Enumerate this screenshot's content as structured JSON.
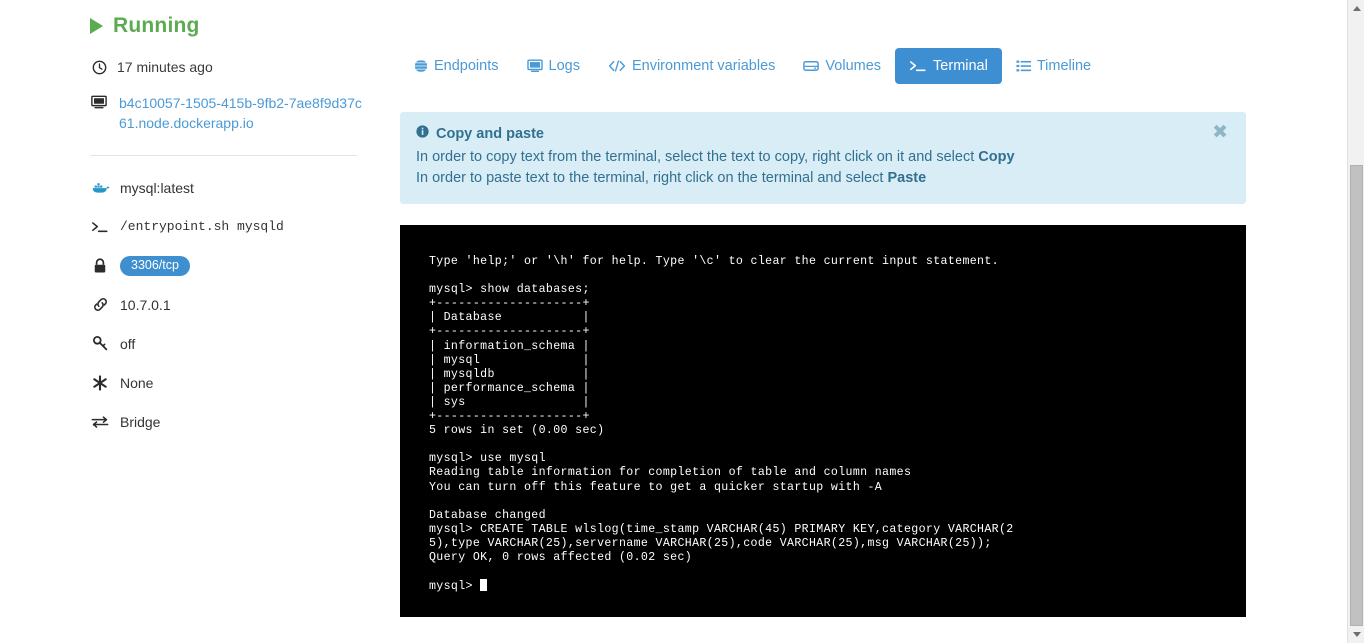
{
  "sidebar": {
    "status": {
      "label": "Running",
      "icon": "play-icon",
      "color": "#5cab52"
    },
    "uptime": {
      "icon": "clock-icon",
      "text": "17 minutes ago"
    },
    "host": {
      "icon": "monitor-icon",
      "link": "b4c10057-1505-415b-9fb2-7ae8f9d37c61.node.dockerapp.io"
    },
    "details": [
      {
        "icon": "docker-whale-icon",
        "label": "mysql:latest",
        "mono": false,
        "badge": false
      },
      {
        "icon": "terminal-prompt-icon",
        "label": "/entrypoint.sh mysqld",
        "mono": true,
        "badge": false
      },
      {
        "icon": "lock-icon",
        "label": "3306/tcp",
        "mono": false,
        "badge": true
      },
      {
        "icon": "link-icon",
        "label": "10.7.0.1",
        "mono": false,
        "badge": false
      },
      {
        "icon": "key-icon",
        "label": "off",
        "mono": false,
        "badge": false
      },
      {
        "icon": "asterisk-icon",
        "label": "None",
        "mono": false,
        "badge": false
      },
      {
        "icon": "exchange-arrows-icon",
        "label": "Bridge",
        "mono": false,
        "badge": false
      }
    ]
  },
  "tabs": [
    {
      "label": "Endpoints",
      "icon": "globe-icon",
      "active": false
    },
    {
      "label": "Logs",
      "icon": "monitor-icon",
      "active": false
    },
    {
      "label": "Environment variables",
      "icon": "code-brackets-icon",
      "active": false
    },
    {
      "label": "Volumes",
      "icon": "hdd-icon",
      "active": false
    },
    {
      "label": "Terminal",
      "icon": "terminal-prompt-icon",
      "active": true
    },
    {
      "label": "Timeline",
      "icon": "list-icon",
      "active": false
    }
  ],
  "banner": {
    "icon": "info-circle-icon",
    "title": "Copy and paste",
    "line1_prefix": "In order to copy text from the terminal, select the text to copy, right click on it and select ",
    "line1_bold": "Copy",
    "line2_prefix": "In order to paste text to the terminal, right click on the terminal and select ",
    "line2_bold": "Paste",
    "close_label": "✖",
    "bg_color": "#d9edf7",
    "text_color": "#31708f"
  },
  "terminal": {
    "background": "#000000",
    "text_color": "#ffffff",
    "content": "Type 'help;' or '\\h' for help. Type '\\c' to clear the current input statement.\n\nmysql> show databases;\n+--------------------+\n| Database           |\n+--------------------+\n| information_schema |\n| mysql              |\n| mysqldb            |\n| performance_schema |\n| sys                |\n+--------------------+\n5 rows in set (0.00 sec)\n\nmysql> use mysql\nReading table information for completion of table and column names\nYou can turn off this feature to get a quicker startup with -A\n\nDatabase changed\nmysql> CREATE TABLE wlslog(time_stamp VARCHAR(45) PRIMARY KEY,category VARCHAR(2\n5),type VARCHAR(25),servername VARCHAR(25),code VARCHAR(25),msg VARCHAR(25));\nQuery OK, 0 rows affected (0.02 sec)\n\n",
    "prompt": "mysql> "
  },
  "scrollbar": {
    "up_arrow": "▲",
    "down_arrow": "▼"
  }
}
